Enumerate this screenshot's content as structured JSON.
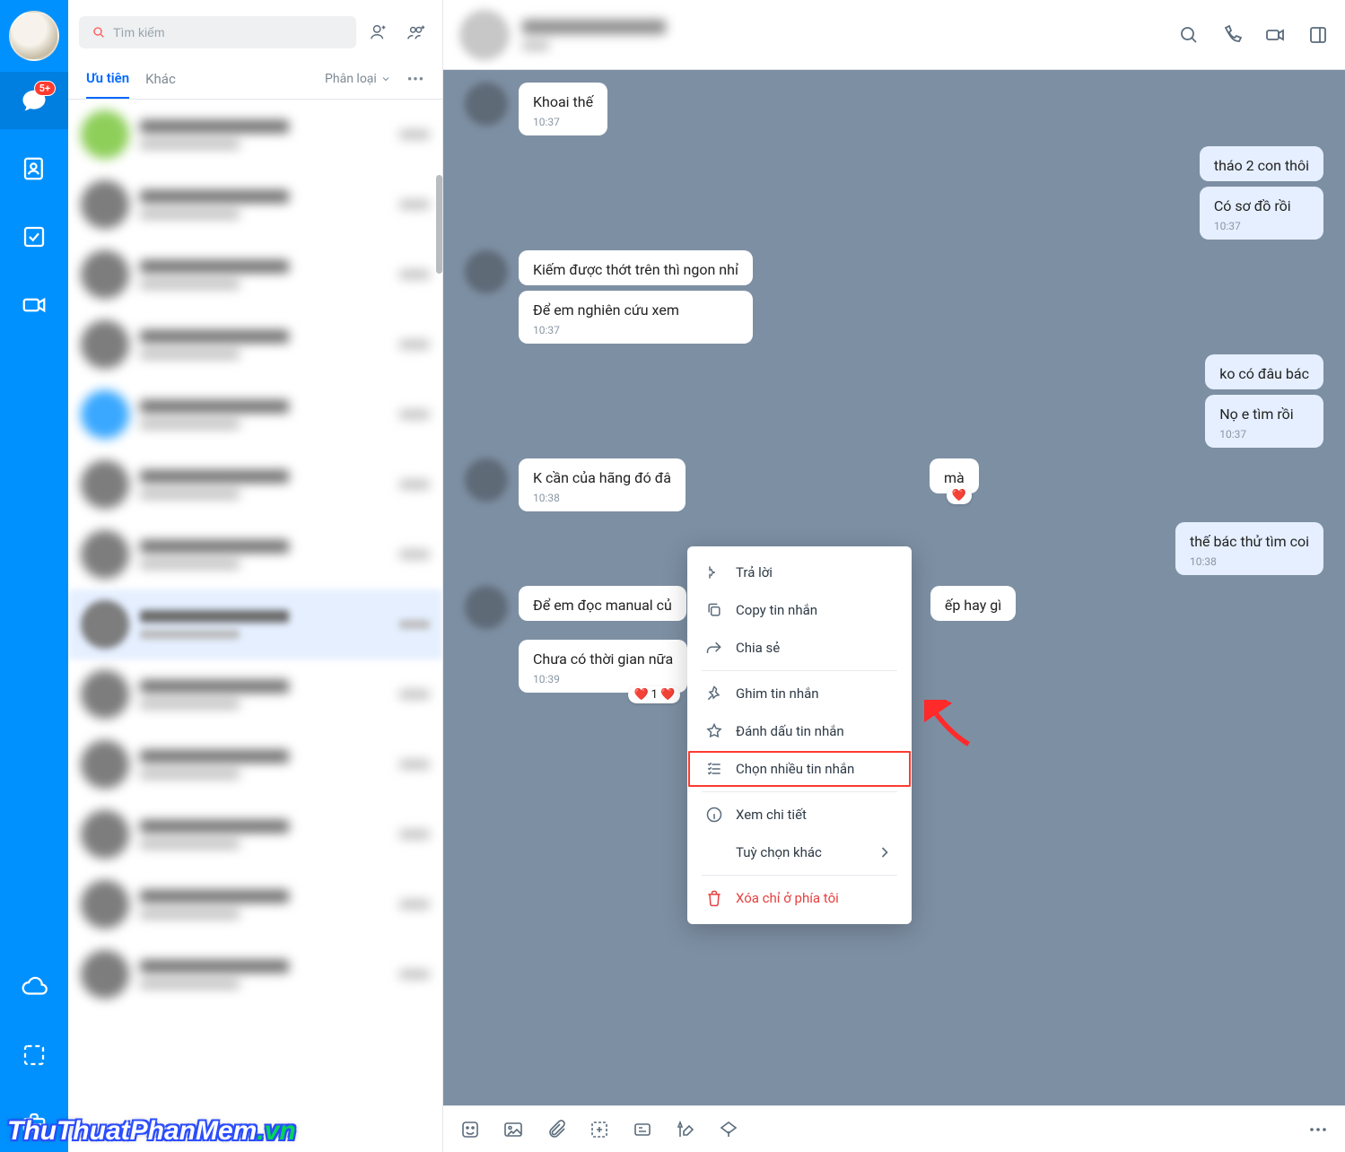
{
  "search": {
    "placeholder": "Tìm kiếm"
  },
  "badge": "5+",
  "tabs": {
    "priority": "Ưu tiên",
    "other": "Khác",
    "classify": "Phân loại"
  },
  "header_actions": [
    "search",
    "call",
    "video",
    "panel"
  ],
  "messages": {
    "m1": {
      "text": "Khoai thế",
      "time": "10:37"
    },
    "m2": {
      "text": "tháo 2 con thôi"
    },
    "m3": {
      "text": "Có sơ đồ rồi",
      "time": "10:37"
    },
    "m4": {
      "text": "Kiếm được thớt trên thì ngon nhỉ"
    },
    "m5": {
      "text": "Để em nghiên cứu xem",
      "time": "10:37"
    },
    "m6": {
      "text": "ko có đâu bác"
    },
    "m7": {
      "text": "Nọ e tìm rồi",
      "time": "10:37"
    },
    "m8": {
      "text": "K cần của hãng đó đâ",
      "time": "10:38",
      "tail": "mà"
    },
    "m9": {
      "text": "thế bác thử tìm coi",
      "time": "10:38"
    },
    "m10": {
      "text": "Để em đọc manual củ",
      "tail": "ếp hay gì"
    },
    "m11": {
      "text": "Chưa có thời gian nữa",
      "time": "10:39"
    },
    "react1": "1"
  },
  "ctx": {
    "reply": "Trả lời",
    "copy": "Copy tin nhắn",
    "share": "Chia sẻ",
    "pin": "Ghim tin nhắn",
    "star": "Đánh dấu tin nhắn",
    "select": "Chọn nhiều tin nhắn",
    "detail": "Xem chi tiết",
    "other": "Tuỳ chọn khác",
    "delete": "Xóa chỉ ở phía tôi"
  },
  "watermark": {
    "a": "ThuThuatPhanMem",
    "b": ".vn"
  }
}
